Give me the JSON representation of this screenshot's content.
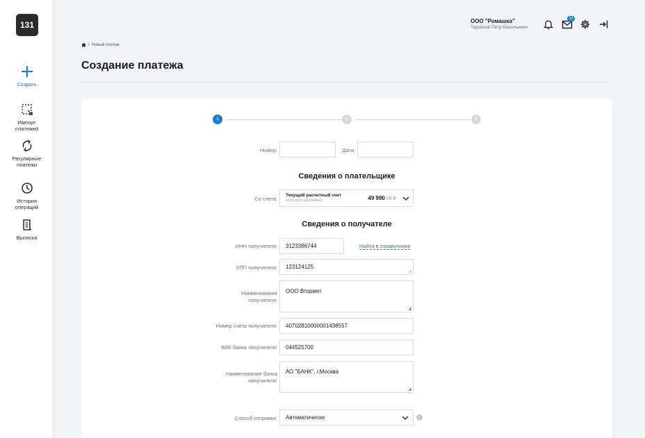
{
  "logo": "131",
  "sidebar": {
    "items": [
      {
        "label": "Создать",
        "icon": "plus-icon"
      },
      {
        "label": "Импорт\nплатежей",
        "icon": "import-icon"
      },
      {
        "label": "Регулярные\nплатежи",
        "icon": "repeat-icon"
      },
      {
        "label": "История\nопераций",
        "icon": "clock-icon"
      },
      {
        "label": "Выписка",
        "icon": "statement-icon"
      }
    ]
  },
  "header": {
    "company": "ООО \"Ромашка\"",
    "user": "Тауринов Пётр Васильевич",
    "mail_badge": "10",
    "icons": [
      "bell-icon",
      "mail-icon",
      "gear-icon",
      "logout-icon"
    ]
  },
  "breadcrumb": {
    "sep": "/",
    "current": "Новый платеж"
  },
  "page_title": "Создание платежа",
  "stepper": {
    "steps": [
      "1",
      "2",
      "3"
    ],
    "active": 1
  },
  "form": {
    "number_label": "Номер:",
    "number_value": "",
    "date_label": "Дата:",
    "date_value": "",
    "payer_title": "Сведения о плательщике",
    "account_label": "Со счета:",
    "account_name": "Текущий расчетный счет",
    "account_number": "40702 810 5 45610000001",
    "balance_int": "49 990",
    "balance_frac": ",00 ₽",
    "recipient_title": "Сведения о получателе",
    "inn_label": "ИНН получателя:",
    "inn_value": "3123386744",
    "find_link": "Найти в справочнике",
    "kpp_label": "КПП получателя:",
    "kpp_value": "123124125",
    "name_label": "Наименование\nполучателя:",
    "name_value": "ООО Втормет",
    "acc_label": "Номер счёта получателя:",
    "acc_value": "40702810000001438557",
    "bik_label": "БИК банка получателя:",
    "bik_value": "044525700",
    "bank_label": "Наименование банка\nполучателя:",
    "bank_value": "АО \"БАНК\", г.Москва",
    "send_label": "Способ отправки:",
    "send_value": "Автоматически"
  },
  "colors": {
    "accent": "#1e7bd8",
    "text": "#1b1b1f",
    "muted": "#6f7077",
    "border": "#d9dadd"
  }
}
